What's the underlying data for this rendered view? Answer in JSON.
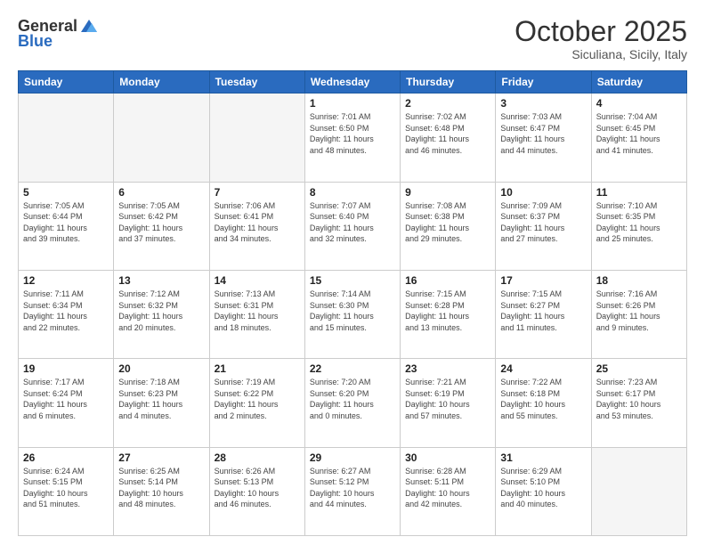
{
  "header": {
    "logo_general": "General",
    "logo_blue": "Blue",
    "month_title": "October 2025",
    "location": "Siculiana, Sicily, Italy"
  },
  "days_of_week": [
    "Sunday",
    "Monday",
    "Tuesday",
    "Wednesday",
    "Thursday",
    "Friday",
    "Saturday"
  ],
  "weeks": [
    [
      {
        "day": "",
        "info": ""
      },
      {
        "day": "",
        "info": ""
      },
      {
        "day": "",
        "info": ""
      },
      {
        "day": "1",
        "info": "Sunrise: 7:01 AM\nSunset: 6:50 PM\nDaylight: 11 hours\nand 48 minutes."
      },
      {
        "day": "2",
        "info": "Sunrise: 7:02 AM\nSunset: 6:48 PM\nDaylight: 11 hours\nand 46 minutes."
      },
      {
        "day": "3",
        "info": "Sunrise: 7:03 AM\nSunset: 6:47 PM\nDaylight: 11 hours\nand 44 minutes."
      },
      {
        "day": "4",
        "info": "Sunrise: 7:04 AM\nSunset: 6:45 PM\nDaylight: 11 hours\nand 41 minutes."
      }
    ],
    [
      {
        "day": "5",
        "info": "Sunrise: 7:05 AM\nSunset: 6:44 PM\nDaylight: 11 hours\nand 39 minutes."
      },
      {
        "day": "6",
        "info": "Sunrise: 7:05 AM\nSunset: 6:42 PM\nDaylight: 11 hours\nand 37 minutes."
      },
      {
        "day": "7",
        "info": "Sunrise: 7:06 AM\nSunset: 6:41 PM\nDaylight: 11 hours\nand 34 minutes."
      },
      {
        "day": "8",
        "info": "Sunrise: 7:07 AM\nSunset: 6:40 PM\nDaylight: 11 hours\nand 32 minutes."
      },
      {
        "day": "9",
        "info": "Sunrise: 7:08 AM\nSunset: 6:38 PM\nDaylight: 11 hours\nand 29 minutes."
      },
      {
        "day": "10",
        "info": "Sunrise: 7:09 AM\nSunset: 6:37 PM\nDaylight: 11 hours\nand 27 minutes."
      },
      {
        "day": "11",
        "info": "Sunrise: 7:10 AM\nSunset: 6:35 PM\nDaylight: 11 hours\nand 25 minutes."
      }
    ],
    [
      {
        "day": "12",
        "info": "Sunrise: 7:11 AM\nSunset: 6:34 PM\nDaylight: 11 hours\nand 22 minutes."
      },
      {
        "day": "13",
        "info": "Sunrise: 7:12 AM\nSunset: 6:32 PM\nDaylight: 11 hours\nand 20 minutes."
      },
      {
        "day": "14",
        "info": "Sunrise: 7:13 AM\nSunset: 6:31 PM\nDaylight: 11 hours\nand 18 minutes."
      },
      {
        "day": "15",
        "info": "Sunrise: 7:14 AM\nSunset: 6:30 PM\nDaylight: 11 hours\nand 15 minutes."
      },
      {
        "day": "16",
        "info": "Sunrise: 7:15 AM\nSunset: 6:28 PM\nDaylight: 11 hours\nand 13 minutes."
      },
      {
        "day": "17",
        "info": "Sunrise: 7:15 AM\nSunset: 6:27 PM\nDaylight: 11 hours\nand 11 minutes."
      },
      {
        "day": "18",
        "info": "Sunrise: 7:16 AM\nSunset: 6:26 PM\nDaylight: 11 hours\nand 9 minutes."
      }
    ],
    [
      {
        "day": "19",
        "info": "Sunrise: 7:17 AM\nSunset: 6:24 PM\nDaylight: 11 hours\nand 6 minutes."
      },
      {
        "day": "20",
        "info": "Sunrise: 7:18 AM\nSunset: 6:23 PM\nDaylight: 11 hours\nand 4 minutes."
      },
      {
        "day": "21",
        "info": "Sunrise: 7:19 AM\nSunset: 6:22 PM\nDaylight: 11 hours\nand 2 minutes."
      },
      {
        "day": "22",
        "info": "Sunrise: 7:20 AM\nSunset: 6:20 PM\nDaylight: 11 hours\nand 0 minutes."
      },
      {
        "day": "23",
        "info": "Sunrise: 7:21 AM\nSunset: 6:19 PM\nDaylight: 10 hours\nand 57 minutes."
      },
      {
        "day": "24",
        "info": "Sunrise: 7:22 AM\nSunset: 6:18 PM\nDaylight: 10 hours\nand 55 minutes."
      },
      {
        "day": "25",
        "info": "Sunrise: 7:23 AM\nSunset: 6:17 PM\nDaylight: 10 hours\nand 53 minutes."
      }
    ],
    [
      {
        "day": "26",
        "info": "Sunrise: 6:24 AM\nSunset: 5:15 PM\nDaylight: 10 hours\nand 51 minutes."
      },
      {
        "day": "27",
        "info": "Sunrise: 6:25 AM\nSunset: 5:14 PM\nDaylight: 10 hours\nand 48 minutes."
      },
      {
        "day": "28",
        "info": "Sunrise: 6:26 AM\nSunset: 5:13 PM\nDaylight: 10 hours\nand 46 minutes."
      },
      {
        "day": "29",
        "info": "Sunrise: 6:27 AM\nSunset: 5:12 PM\nDaylight: 10 hours\nand 44 minutes."
      },
      {
        "day": "30",
        "info": "Sunrise: 6:28 AM\nSunset: 5:11 PM\nDaylight: 10 hours\nand 42 minutes."
      },
      {
        "day": "31",
        "info": "Sunrise: 6:29 AM\nSunset: 5:10 PM\nDaylight: 10 hours\nand 40 minutes."
      },
      {
        "day": "",
        "info": ""
      }
    ]
  ]
}
